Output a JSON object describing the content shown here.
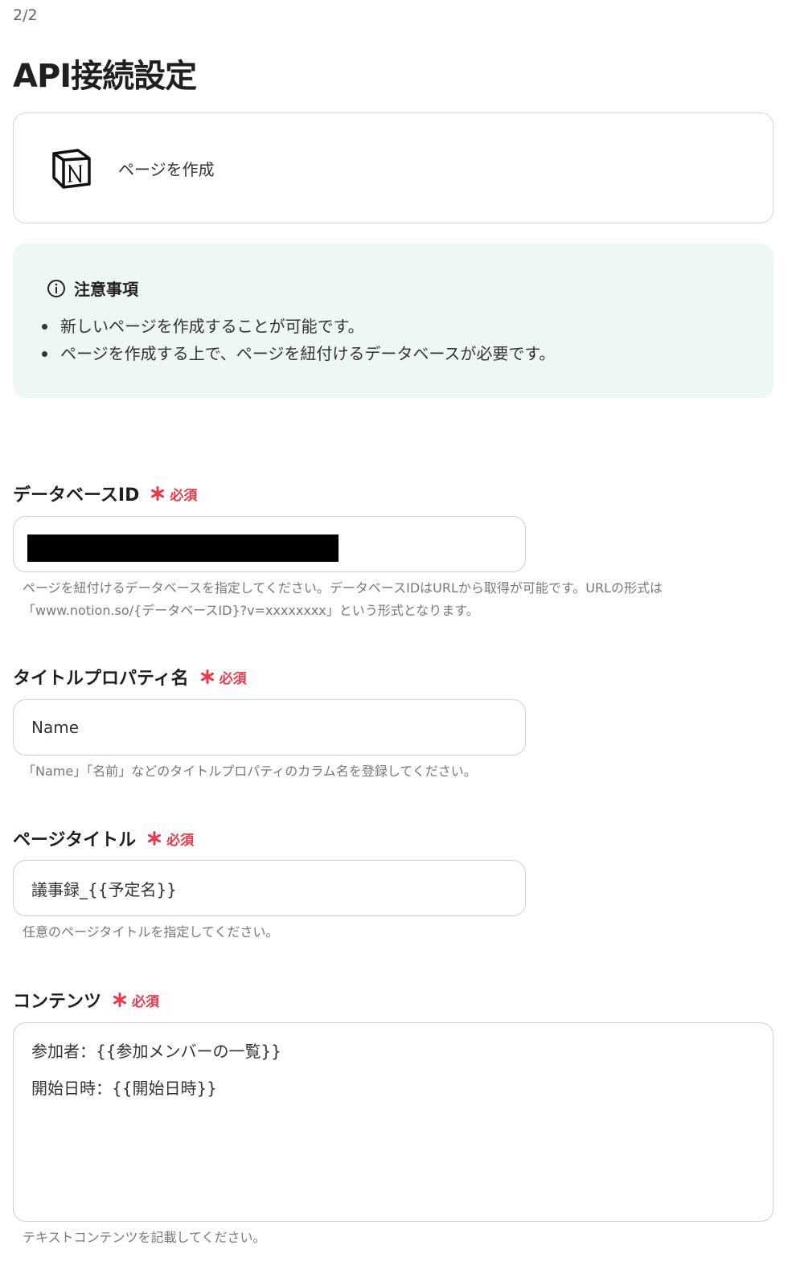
{
  "step": "2/2",
  "title": "API接続設定",
  "action": {
    "icon": "notion-logo",
    "name": "ページを作成"
  },
  "notice": {
    "title": "注意事項",
    "items": [
      "新しいページを作成することが可能です。",
      "ページを作成する上で、ページを紐付けるデータベースが必要です。"
    ]
  },
  "required_label": "必須",
  "fields": {
    "database_id": {
      "label": "データベースID",
      "value": "",
      "hint_line1": "ページを紐付けるデータベースを指定してください。データベースIDはURLから取得が可能です。URLの形式は",
      "hint_line2": "「www.notion.so/{データベースID}?v=xxxxxxxx」という形式となります。"
    },
    "title_property": {
      "label": "タイトルプロパティ名",
      "value": "Name",
      "hint": "「Name」「名前」などのタイトルプロパティのカラム名を登録してください。"
    },
    "page_title": {
      "label": "ページタイトル",
      "value": "議事録_{{予定名}}",
      "hint": "任意のページタイトルを指定してください。"
    },
    "content": {
      "label": "コンテンツ",
      "lines": [
        "参加者：{{参加メンバーの一覧}}",
        "開始日時：{{開始日時}}"
      ],
      "hint": "テキストコンテンツを記載してください。"
    }
  },
  "colors": {
    "required": "#e8394a",
    "notice_bg": "#eff7f6",
    "border": "#cfcfcf"
  }
}
